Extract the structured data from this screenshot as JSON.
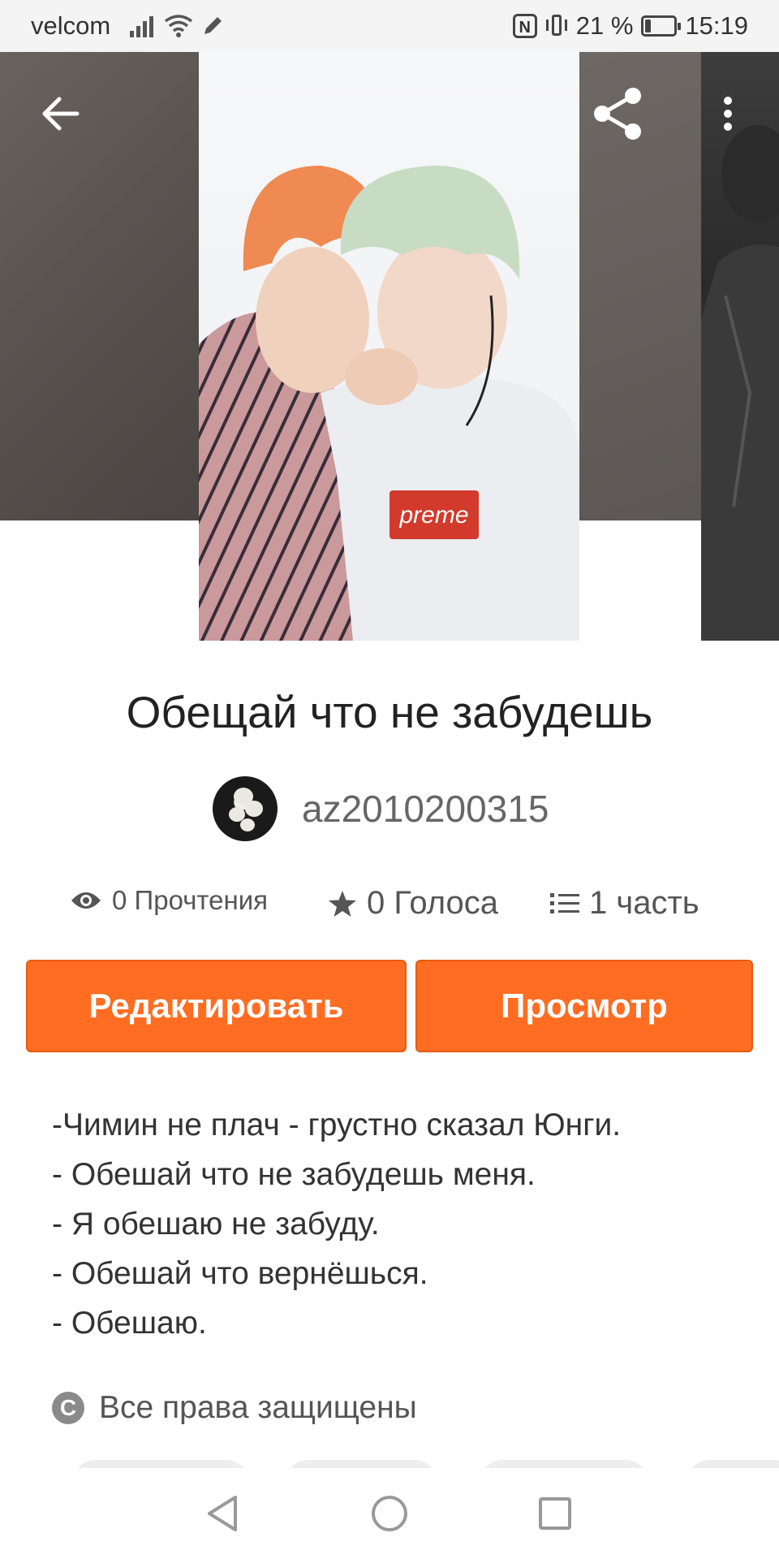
{
  "status_bar": {
    "carrier": "velcom",
    "battery_percent": "21 %",
    "battery_level": 0.21,
    "time": "15:19"
  },
  "toolbar": {
    "back_icon": "arrow-left-icon",
    "share_icon": "share-icon",
    "menu_icon": "more-vertical-icon"
  },
  "story": {
    "title": "Обещай что не забудешь",
    "author": "az2010200315",
    "stats": {
      "reads": "0 Прочтения",
      "votes": "0 Голоса",
      "parts": "1 часть"
    },
    "buttons": {
      "edit": "Редактировать",
      "view": "Просмотр"
    },
    "description_lines": [
      "-Чимин не плач - грустно сказал Юнги.",
      "- Обешай что не забудешь меня.",
      "- Я обешаю не забуду.",
      "- Обешай что вернёшься.",
      "- Обешаю."
    ],
    "copyright": "Все права защищены"
  },
  "colors": {
    "accent": "#ff6d22",
    "text_primary": "#222222",
    "text_secondary": "#666666"
  }
}
